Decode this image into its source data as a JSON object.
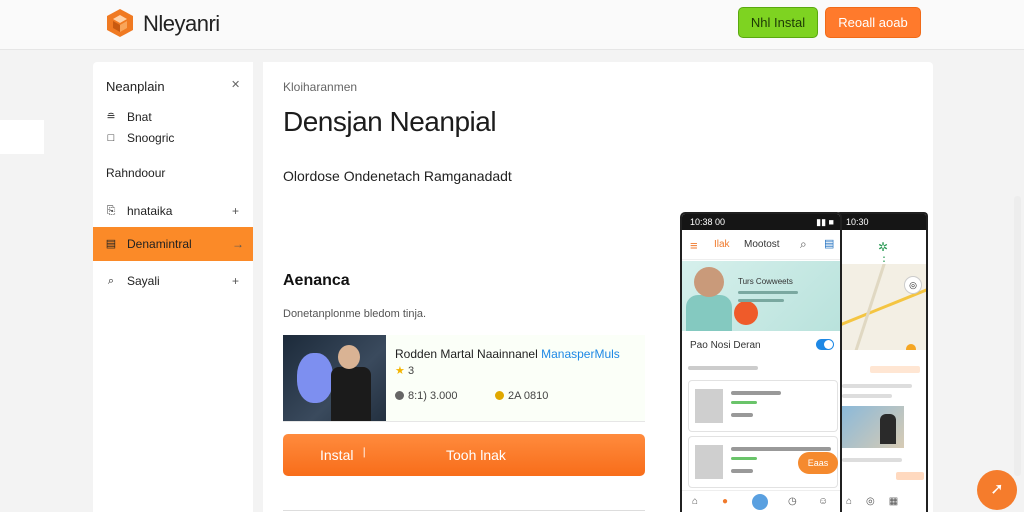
{
  "header": {
    "brand": "Nleyanri",
    "primary_button": "Nhl Instal",
    "secondary_button": "Reoall aoab"
  },
  "sidebar": {
    "title": "Neanplain",
    "close_glyph": "✕",
    "items": [
      {
        "label": "Bnat",
        "icon": "layers-icon",
        "glyph": "≘"
      },
      {
        "label": "Snoogric",
        "icon": "square-icon",
        "glyph": "□"
      },
      {
        "label": "Rahndoour",
        "icon": "",
        "glyph": ""
      },
      {
        "label": "hnataika",
        "icon": "bookmark-icon",
        "glyph": "⎘",
        "action": "+"
      },
      {
        "label": "Denamintral",
        "icon": "file-icon",
        "glyph": "▤",
        "action": "→",
        "active": true
      },
      {
        "label": "Sayali",
        "icon": "search-icon",
        "glyph": "⌕",
        "action": "+"
      }
    ]
  },
  "main": {
    "breadcrumb": "Kloiharanmen",
    "title": "Densjan Neanpial",
    "subtitle": "Olordose Ondenetach Ramganadadt",
    "section_title": "Aenanca",
    "section_desc": "Donetanplonme bledom tinja.",
    "card": {
      "title": "Rodden Martal Naainnanel",
      "link": "ManasperMuls",
      "rating": "3",
      "stat1": "8:1) 3.000",
      "stat2": "2A 0810"
    },
    "install_label": "Instal",
    "install_sep": "❘",
    "action_label": "Tooh lnak"
  },
  "phone_front": {
    "status_time": "10:38 00",
    "status_right": "▮▮ ■",
    "tab_active": "Ilak",
    "tab_other": "Mootost",
    "banner_title": "Turs Cowweets",
    "toggle_label": "Pao Nosi Deran",
    "fab": "Eaas"
  },
  "phone_back": {
    "status_time": "10:30",
    "top_icons": "✲ ⋮"
  },
  "colors": {
    "accent_orange": "#fb8a28",
    "accent_green": "#7ed321",
    "link_blue": "#1e88e5"
  }
}
